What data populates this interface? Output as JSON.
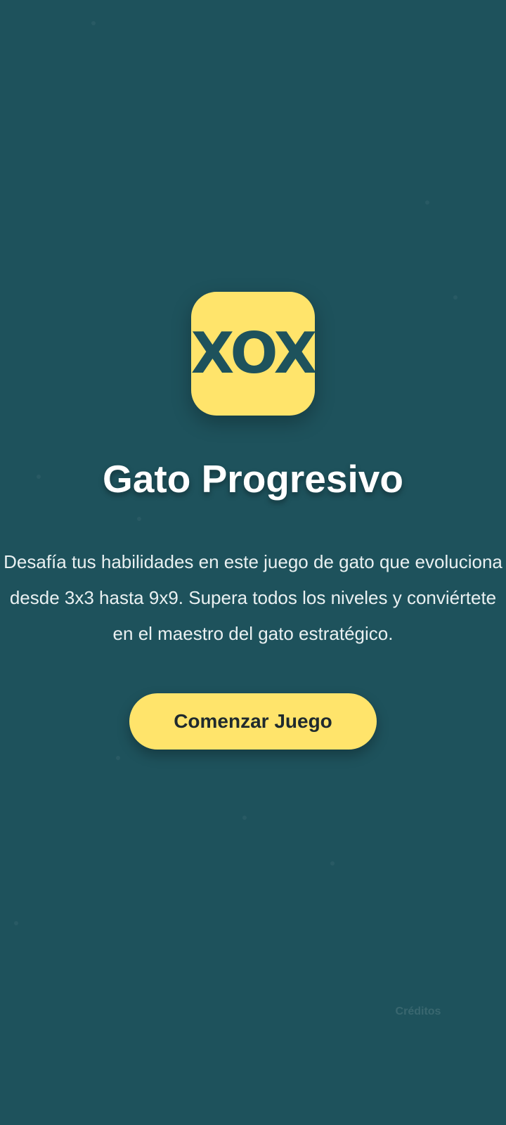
{
  "app": {
    "logo_text": "XOX",
    "title": "Gato Progresivo",
    "description": "Desafía tus habilidades en este juego de gato que evoluciona desde 3x3 hasta 9x9. Supera todos los niveles y conviértete en el maestro del gato estratégico.",
    "start_button_label": "Comenzar Juego",
    "credits_label": "Créditos"
  },
  "colors": {
    "background": "#1e525c",
    "accent": "#ffe46b",
    "title_text": "#ffffff",
    "description_text": "#e9f0f1",
    "button_text": "#1f2a2e"
  }
}
